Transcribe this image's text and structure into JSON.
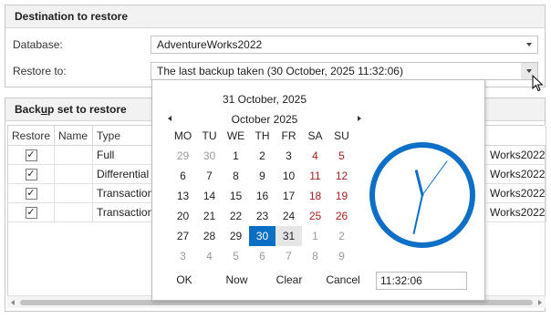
{
  "destination": {
    "header": "Destination to restore",
    "database_label": "Database:",
    "database_value": "AdventureWorks2022",
    "restore_to_label": "Restore to:",
    "restore_to_value": "The last backup taken (30 October, 2025 11:32:06)"
  },
  "backup_set": {
    "header_prefix": "Back",
    "header_underlined": "u",
    "header_suffix": "p set to restore",
    "columns": [
      "Restore",
      "Name",
      "Type"
    ],
    "rows": [
      {
        "checked": true,
        "name": "",
        "type": "Full",
        "database": "Works2022"
      },
      {
        "checked": true,
        "name": "",
        "type": "Differential",
        "database": "Works2022"
      },
      {
        "checked": true,
        "name": "",
        "type": "Transaction",
        "database": "Works2022"
      },
      {
        "checked": true,
        "name": "",
        "type": "Transaction",
        "database": "Works2022"
      }
    ]
  },
  "calendar": {
    "selected_date_title": "31 October, 2025",
    "month_label": "October 2025",
    "weekdays": [
      "MO",
      "TU",
      "WE",
      "TH",
      "FR",
      "SA",
      "SU"
    ],
    "weeks": [
      [
        "29",
        "30",
        "1",
        "2",
        "3",
        "4",
        "5"
      ],
      [
        "6",
        "7",
        "8",
        "9",
        "10",
        "11",
        "12"
      ],
      [
        "13",
        "14",
        "15",
        "16",
        "17",
        "18",
        "19"
      ],
      [
        "20",
        "21",
        "22",
        "23",
        "24",
        "25",
        "26"
      ],
      [
        "27",
        "28",
        "29",
        "30",
        "31",
        "1",
        "2"
      ],
      [
        "3",
        "4",
        "5",
        "6",
        "7",
        "8",
        "9"
      ]
    ],
    "selected_day": "30",
    "today_day": "31",
    "buttons": {
      "ok": "OK",
      "now": "Now",
      "clear": "Clear",
      "cancel": "Cancel"
    },
    "time_value": "11:32:06",
    "clock": {
      "hour": 11,
      "minute": 32,
      "second": 6
    }
  },
  "colors": {
    "accent": "#0b6fc4",
    "weekend": "#a32020",
    "muted": "#9a9a9a",
    "clock_ring": "#0e6fc7",
    "header_bg": "#f2f2f2"
  },
  "icons": {
    "dropdown": "chevron-down-icon",
    "prev": "arrow-left-icon",
    "next": "arrow-right-icon",
    "check": "check-icon",
    "cursor": "mouse-pointer-icon",
    "clock": "clock-icon"
  }
}
